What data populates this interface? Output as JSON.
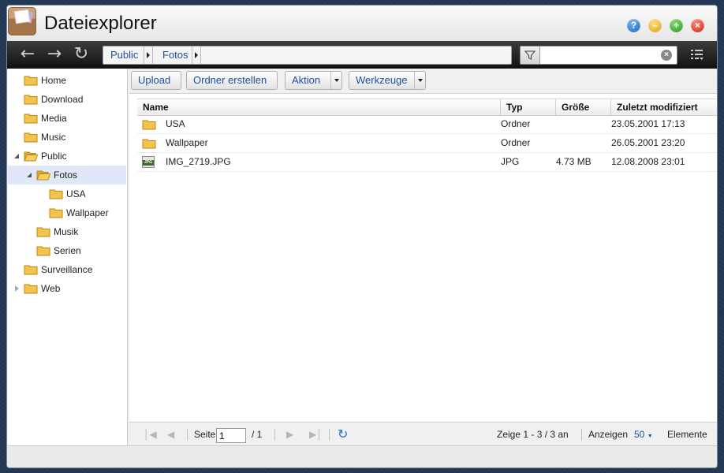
{
  "window": {
    "title": "Dateiexplorer"
  },
  "breadcrumb": [
    "Public",
    "Fotos"
  ],
  "search": {
    "value": ""
  },
  "sidebar": {
    "items": [
      {
        "label": "Home"
      },
      {
        "label": "Download"
      },
      {
        "label": "Media"
      },
      {
        "label": "Music"
      },
      {
        "label": "Public"
      },
      {
        "label": "Fotos"
      },
      {
        "label": "USA"
      },
      {
        "label": "Wallpaper"
      },
      {
        "label": "Musik"
      },
      {
        "label": "Serien"
      },
      {
        "label": "Surveillance"
      },
      {
        "label": "Web"
      }
    ]
  },
  "actions": {
    "upload": "Upload",
    "create_folder": "Ordner erstellen",
    "action": "Aktion",
    "tools": "Werkzeuge"
  },
  "grid": {
    "columns": [
      "Name",
      "Typ",
      "Größe",
      "Zuletzt modifiziert"
    ],
    "rows": [
      {
        "name": "USA",
        "type": "Ordner",
        "size": "",
        "modified": "23.05.2001 17:13",
        "icon": "folder-icon"
      },
      {
        "name": "Wallpaper",
        "type": "Ordner",
        "size": "",
        "modified": "26.05.2001 23:20",
        "icon": "folder-icon"
      },
      {
        "name": "IMG_2719.JPG",
        "type": "JPG",
        "size": "4.73 MB",
        "modified": "12.08.2008 23:01",
        "icon": "jpg-file-icon"
      }
    ]
  },
  "pager": {
    "page_label": "Seite",
    "page_value": "1",
    "page_total": "/ 1",
    "summary": "Zeige 1 - 3 / 3 an",
    "show_label": "Anzeigen",
    "per_page": "50",
    "items_label": "Elemente"
  },
  "colors": {
    "accent": "#1c4f9c",
    "selected": "#dfe8f6",
    "toolbar": "#1a1a1a"
  }
}
